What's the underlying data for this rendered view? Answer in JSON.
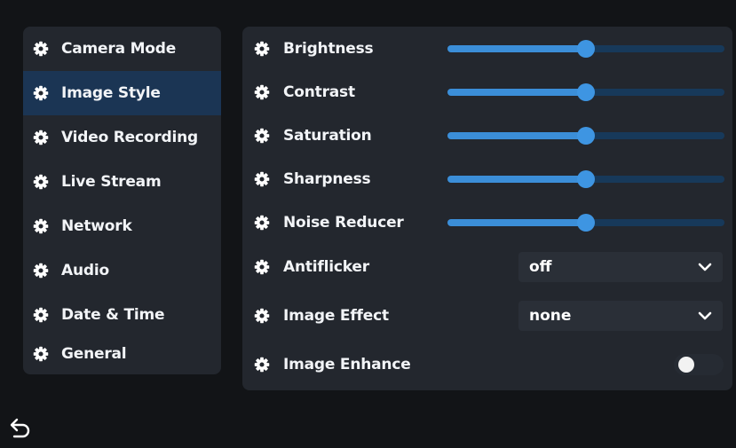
{
  "sidebar": {
    "items": [
      {
        "label": "Camera Mode",
        "icon": "gear-icon",
        "active": false
      },
      {
        "label": "Image Style",
        "icon": "gear-icon",
        "active": true
      },
      {
        "label": "Video Recording",
        "icon": "gear-icon",
        "active": false
      },
      {
        "label": "Live Stream",
        "icon": "gear-icon",
        "active": false
      },
      {
        "label": "Network",
        "icon": "gear-icon",
        "active": false
      },
      {
        "label": "Audio",
        "icon": "gear-icon",
        "active": false
      },
      {
        "label": "Date & Time",
        "icon": "gear-icon",
        "active": false
      },
      {
        "label": "General",
        "icon": "gear-icon",
        "active": false
      }
    ]
  },
  "settings": {
    "brightness": {
      "label": "Brightness",
      "value": 50,
      "max": 100
    },
    "contrast": {
      "label": "Contrast",
      "value": 50,
      "max": 100
    },
    "saturation": {
      "label": "Saturation",
      "value": 50,
      "max": 100
    },
    "sharpness": {
      "label": "Sharpness",
      "value": 50,
      "max": 100
    },
    "noise_reducer": {
      "label": "Noise Reducer",
      "value": 50,
      "max": 100
    },
    "antiflicker": {
      "label": "Antiflicker",
      "value": "off"
    },
    "image_effect": {
      "label": "Image Effect",
      "value": "none"
    },
    "image_enhance": {
      "label": "Image Enhance",
      "enabled": false
    }
  },
  "footer": {
    "back_icon": "back-arrow-icon"
  },
  "colors": {
    "accent": "#3e95e2",
    "track": "#17395a",
    "panel": "#23272e",
    "active_item": "#1b3554",
    "background": "#121417"
  }
}
